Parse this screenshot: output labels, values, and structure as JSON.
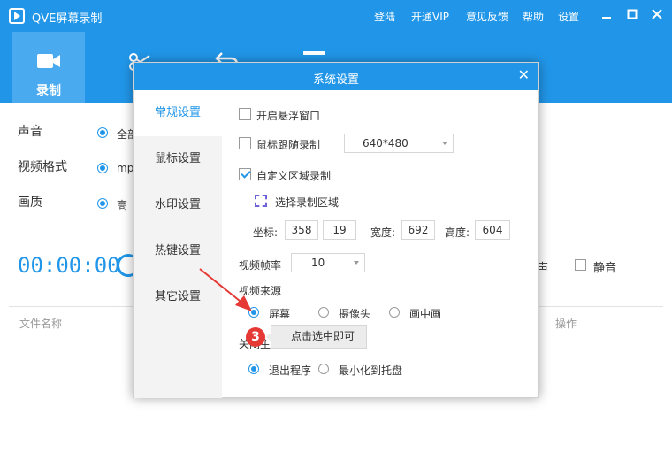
{
  "app": {
    "title": "QVE屏幕录制",
    "links": [
      "登陆",
      "开通VIP",
      "意见反馈",
      "帮助",
      "设置"
    ],
    "window_controls": [
      "minimize-icon",
      "maximize-icon",
      "close-icon"
    ],
    "accent_color": "#2196e8"
  },
  "toolbar": {
    "tabs": [
      {
        "label": "录制",
        "icon": "video-camera-icon",
        "active": true
      },
      {
        "label": "剪",
        "icon": "scissors-icon",
        "active": false
      },
      {
        "label": "",
        "icon": "undo-icon",
        "active": false
      },
      {
        "label": "",
        "icon": "menu-icon",
        "active": false
      }
    ]
  },
  "main": {
    "sound_label": "声音",
    "sound_value": "全部",
    "format_label": "视频格式",
    "format_value": "mp",
    "quality_label": "画质",
    "quality_value": "高",
    "timer": "00:00:00",
    "sound_option": "声",
    "mute_label": "静音",
    "col_filename": "文件名称",
    "col_actions": "操作"
  },
  "dialog": {
    "title": "系统设置",
    "sidebar": [
      "常规设置",
      "鼠标设置",
      "水印设置",
      "热键设置",
      "其它设置"
    ],
    "floating_window": {
      "label": "开启悬浮窗口",
      "checked": false
    },
    "mouse_follow": {
      "label": "鼠标跟随录制",
      "checked": false,
      "resolution": "640*480"
    },
    "custom_region": {
      "label": "自定义区域录制",
      "checked": true
    },
    "select_region_label": "选择录制区域",
    "coords_label": "坐标:",
    "coord_x": "358",
    "coord_y": "19",
    "width_label": "宽度:",
    "width_value": "692",
    "height_label": "高度:",
    "height_value": "604",
    "fps_label": "视频帧率",
    "fps_value": "10",
    "source_label": "视频来源",
    "sources": [
      {
        "label": "屏幕",
        "selected": true
      },
      {
        "label": "摄像头",
        "selected": false
      },
      {
        "label": "画中画",
        "selected": false
      }
    ],
    "close_action_label": "关闭主窗口时",
    "close_options": [
      {
        "label": "退出程序",
        "selected": true
      },
      {
        "label": "最小化到托盘",
        "selected": false
      }
    ]
  },
  "annotation": {
    "step": "3",
    "tooltip": "点击选中即可",
    "arrow_color": "#e53935"
  }
}
